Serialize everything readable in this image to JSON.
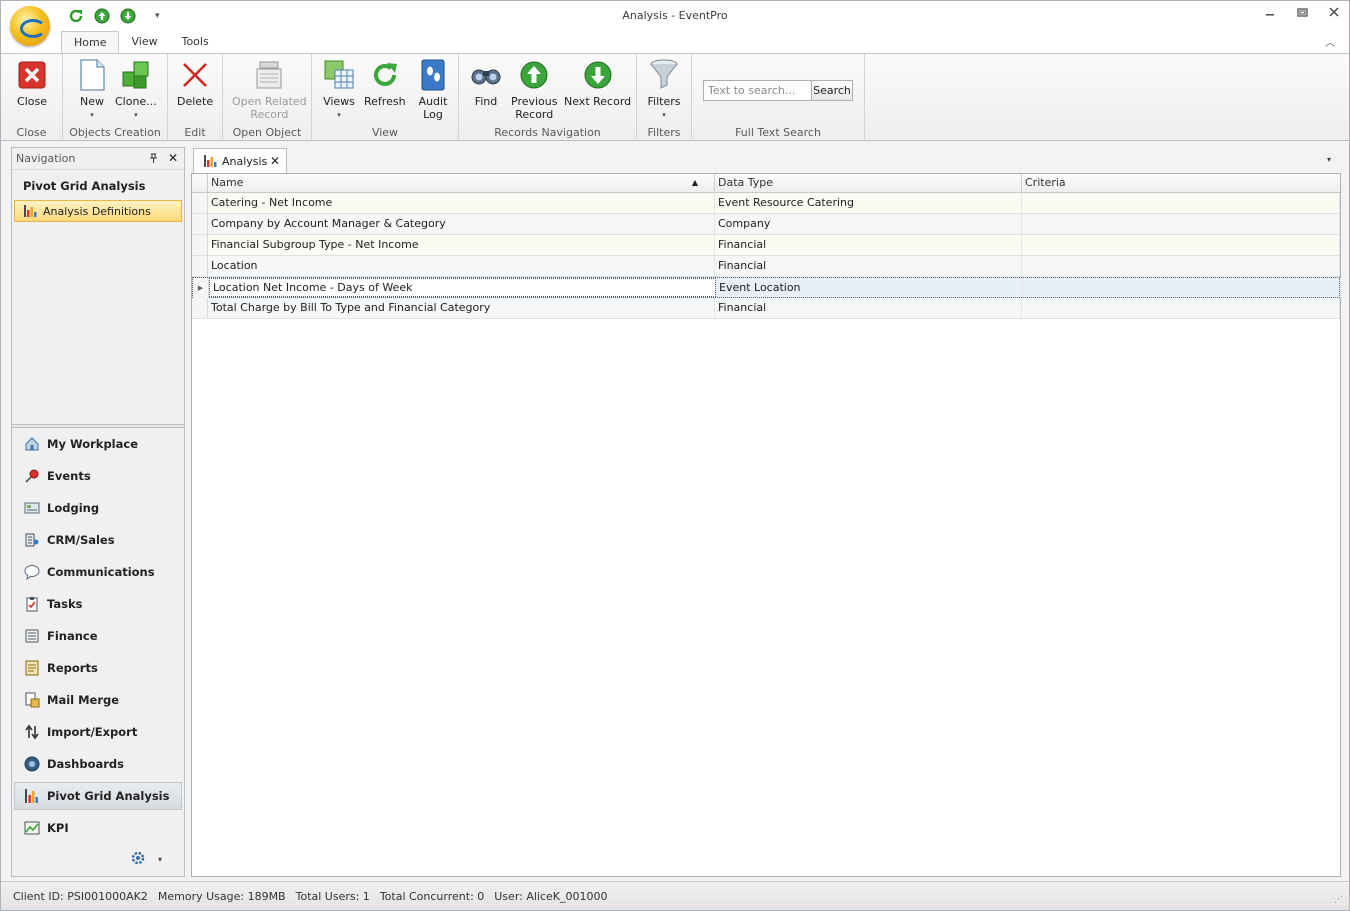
{
  "window": {
    "title": "Analysis - EventPro",
    "controls": {
      "minimize": "—",
      "restore": "▣",
      "close": "✕"
    }
  },
  "quick_access": {
    "items": [
      "refresh-icon",
      "arrow-up-icon",
      "arrow-down-icon"
    ],
    "dropdown": "▾"
  },
  "ribbon": {
    "tabs": [
      {
        "label": "Home",
        "active": true
      },
      {
        "label": "View",
        "active": false
      },
      {
        "label": "Tools",
        "active": false
      }
    ],
    "collapse_glyph": "︿",
    "groups": {
      "close": {
        "label": "Close",
        "buttons": {
          "close": "Close"
        }
      },
      "objects_creation": {
        "label": "Objects Creation",
        "buttons": {
          "new": "New",
          "clone": "Clone..."
        }
      },
      "edit": {
        "label": "Edit",
        "buttons": {
          "delete": "Delete"
        }
      },
      "open_object": {
        "label": "Open Object",
        "buttons": {
          "open_related_line1": "Open Related",
          "open_related_line2": "Record"
        }
      },
      "view": {
        "label": "View",
        "buttons": {
          "views": "Views",
          "refresh": "Refresh",
          "audit_line1": "Audit",
          "audit_line2": "Log"
        }
      },
      "records_navigation": {
        "label": "Records Navigation",
        "buttons": {
          "find": "Find",
          "previous_line1": "Previous",
          "previous_line2": "Record",
          "next": "Next Record"
        }
      },
      "filters": {
        "label": "Filters",
        "buttons": {
          "filters": "Filters"
        }
      },
      "full_text_search": {
        "label": "Full Text Search",
        "placeholder": "Text to search...",
        "button": "Search"
      }
    },
    "dropdown_glyph": "▾"
  },
  "navigation": {
    "header": "Navigation",
    "pin_glyph": "📌",
    "close_glyph": "✕",
    "section_title": "Pivot Grid Analysis",
    "tree_items": [
      {
        "label": "Analysis Definitions",
        "selected": true
      }
    ],
    "groups": [
      {
        "label": "My Workplace",
        "icon": "house-icon"
      },
      {
        "label": "Events",
        "icon": "pushpin-icon"
      },
      {
        "label": "Lodging",
        "icon": "bed-icon"
      },
      {
        "label": "CRM/Sales",
        "icon": "building-icon"
      },
      {
        "label": "Communications",
        "icon": "speech-bubble-icon"
      },
      {
        "label": "Tasks",
        "icon": "clipboard-icon"
      },
      {
        "label": "Finance",
        "icon": "ledger-icon"
      },
      {
        "label": "Reports",
        "icon": "report-icon"
      },
      {
        "label": "Mail Merge",
        "icon": "mail-merge-icon"
      },
      {
        "label": "Import/Export",
        "icon": "import-export-icon"
      },
      {
        "label": "Dashboards",
        "icon": "gauge-icon"
      },
      {
        "label": "Pivot Grid Analysis",
        "icon": "bar-chart-icon",
        "selected": true
      },
      {
        "label": "KPI",
        "icon": "line-chart-icon"
      }
    ],
    "config_glyph": "⚙",
    "config_dropdown": "▾"
  },
  "document": {
    "tab_label": "Analysis",
    "tab_close": "✕",
    "menu_glyph": "▾",
    "columns": [
      "Name",
      "Data Type",
      "Criteria"
    ],
    "sort_glyph": "▲",
    "rows": [
      {
        "name": "Catering - Net Income",
        "data_type": "Event Resource Catering",
        "criteria": ""
      },
      {
        "name": "Company by Account Manager & Category",
        "data_type": "Company",
        "criteria": ""
      },
      {
        "name": "Financial Subgroup Type - Net Income",
        "data_type": "Financial",
        "criteria": ""
      },
      {
        "name": "Location",
        "data_type": "Financial",
        "criteria": ""
      },
      {
        "name": "Location Net Income - Days of Week",
        "data_type": "Event Location",
        "criteria": "",
        "focused": true
      },
      {
        "name": "Total Charge by Bill To Type and Financial Category",
        "data_type": "Financial",
        "criteria": ""
      }
    ],
    "row_indicator": "▶"
  },
  "status": {
    "client_id": "Client ID: PSI001000AK2",
    "memory": "Memory Usage: 189MB",
    "total_users": "Total Users: 1",
    "total_concurrent": "Total Concurrent: 0",
    "user": "User: AliceK_001000",
    "grip": "⋰"
  }
}
